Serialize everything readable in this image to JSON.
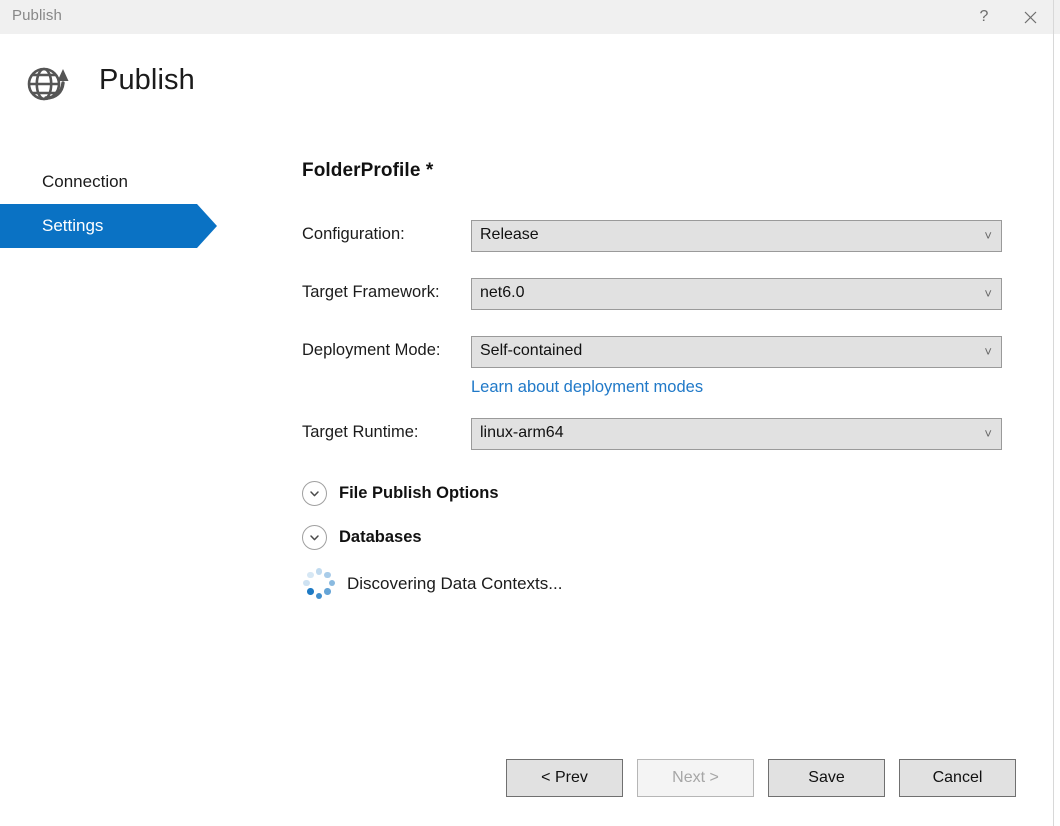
{
  "titlebar": {
    "title": "Publish",
    "help_icon": "question-mark-icon",
    "close_icon": "close-icon"
  },
  "header": {
    "title": "Publish",
    "icon": "globe-publish-icon"
  },
  "sidebar": {
    "items": [
      {
        "label": "Connection",
        "selected": false
      },
      {
        "label": "Settings",
        "selected": true
      }
    ]
  },
  "main": {
    "profile_title": "FolderProfile *",
    "fields": [
      {
        "label": "Configuration:",
        "value": "Release"
      },
      {
        "label": "Target Framework:",
        "value": "net6.0"
      },
      {
        "label": "Deployment Mode:",
        "value": "Self-contained"
      },
      {
        "label": "Target Runtime:",
        "value": "linux-arm64"
      }
    ],
    "deployment_help_link": "Learn about deployment modes",
    "expanders": [
      {
        "label": "File Publish Options",
        "icon": "chevron-down-circle-icon"
      },
      {
        "label": "Databases",
        "icon": "chevron-down-circle-icon"
      }
    ],
    "status": {
      "text": "Discovering Data Contexts...",
      "icon": "loading-spinner-icon"
    }
  },
  "footer": {
    "buttons": [
      {
        "label": "< Prev",
        "disabled": false
      },
      {
        "label": "Next >",
        "disabled": true
      },
      {
        "label": "Save",
        "disabled": false
      },
      {
        "label": "Cancel",
        "disabled": false
      }
    ]
  },
  "colors": {
    "accent_blue": "#0a72c4",
    "link_blue": "#2079c8",
    "titlebar_bg": "#f0f0f0",
    "control_bg": "#e1e1e1",
    "control_border": "#9a9a9a",
    "button_border": "#707070",
    "spinner_blue": "#1e7ac4"
  }
}
